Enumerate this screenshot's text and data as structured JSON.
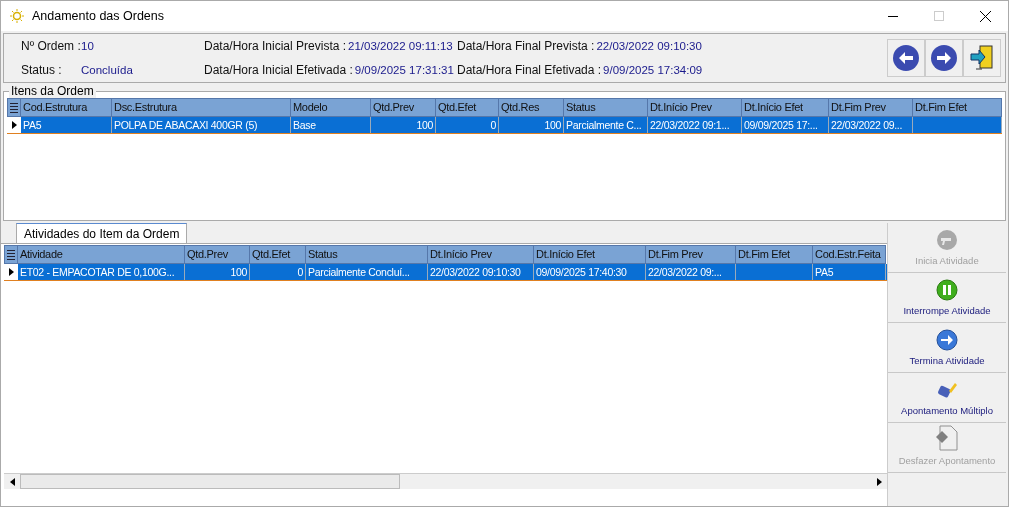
{
  "window": {
    "title": "Andamento das Ordens"
  },
  "header": {
    "fields": [
      {
        "label": "Nº Ordem :",
        "value": "10"
      },
      {
        "label": "Status :",
        "value": "Concluída"
      },
      {
        "label": "Data/Hora Inicial Prevista :",
        "value": "21/03/2022 09:11:13"
      },
      {
        "label": "Data/Hora Inicial Efetivada :",
        "value": "9/09/2025 17:31:31"
      },
      {
        "label": "Data/Hora Final Prevista :",
        "value": "22/03/2022 09:10:30"
      },
      {
        "label": "Data/Hora Final Efetivada :",
        "value": "9/09/2025 17:34:09"
      }
    ]
  },
  "items_group": {
    "title": "Itens da Ordem",
    "columns": [
      {
        "label": "Cod.Estrutura",
        "numeric": false
      },
      {
        "label": "Dsc.Estrutura",
        "numeric": false
      },
      {
        "label": "Modelo",
        "numeric": false
      },
      {
        "label": "Qtd.Prev",
        "numeric": true
      },
      {
        "label": "Qtd.Efet",
        "numeric": true
      },
      {
        "label": "Qtd.Res",
        "numeric": true
      },
      {
        "label": "Status",
        "numeric": false
      },
      {
        "label": "Dt.Início Prev",
        "numeric": false
      },
      {
        "label": "Dt.Início Efet",
        "numeric": false
      },
      {
        "label": "Dt.Fim Prev",
        "numeric": false
      },
      {
        "label": "Dt.Fim Efet"
      }
    ],
    "rows": [
      {
        "selected": true,
        "cells": [
          "PA5",
          "POLPA DE ABACAXI 400GR  (5)",
          "Base",
          "100",
          "0",
          "100",
          "Parcialmente C...",
          "22/03/2022 09:1...",
          "09/09/2025 17:...",
          "22/03/2022 09...",
          ""
        ]
      }
    ]
  },
  "tabs": [
    {
      "label": "Atividades do Item da Ordem",
      "selected": true
    }
  ],
  "activities": {
    "columns": [
      {
        "label": "Atividade",
        "numeric": false
      },
      {
        "label": "Qtd.Prev",
        "numeric": true
      },
      {
        "label": "Qtd.Efet",
        "numeric": true
      },
      {
        "label": "Status",
        "numeric": false
      },
      {
        "label": "Dt.Início Prev",
        "numeric": false
      },
      {
        "label": "Dt.Início Efet",
        "numeric": false
      },
      {
        "label": "Dt.Fim Prev",
        "numeric": false
      },
      {
        "label": "Dt.Fim Efet"
      },
      {
        "label": "Cod.Estr.Feita",
        "numeric": false
      }
    ],
    "rows": [
      {
        "selected": true,
        "cells": [
          "ET02 - EMPACOTAR DE 0,100G...",
          "100",
          "0",
          "Parcialmente Concluí...",
          "22/03/2022 09:10:30",
          "09/09/2025 17:40:30",
          "22/03/2022 09:...",
          "",
          "PA5"
        ]
      }
    ]
  },
  "actions": [
    {
      "label": "Inicia Atividade",
      "kind": "start",
      "disabled": true
    },
    {
      "label": "Interrompe Atividade",
      "kind": "pause",
      "disabled": false
    },
    {
      "label": "Termina Atividade",
      "kind": "finish",
      "disabled": false
    },
    {
      "label": "Apontamento Múltiplo",
      "kind": "multi",
      "disabled": false
    },
    {
      "label": "Desfazer Apontamento",
      "kind": "undo",
      "disabled": true
    }
  ]
}
